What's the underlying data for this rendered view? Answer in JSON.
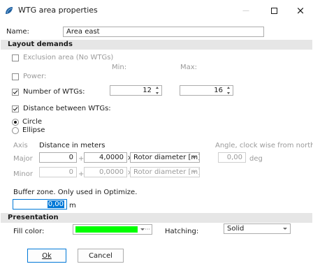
{
  "window": {
    "title": "WTG area properties",
    "minimize_glyph": "—",
    "close_glyph": "×"
  },
  "name_row": {
    "label": "Name:",
    "value": "Area east"
  },
  "layout": {
    "header": "Layout demands",
    "exclusion": {
      "label": "Exclusion area (No WTGs)",
      "checked": false
    },
    "min_label": "Min:",
    "max_label": "Max:",
    "power": {
      "label": "Power:",
      "checked": false
    },
    "number": {
      "label": "Number of WTGs:",
      "checked": true,
      "min": "12",
      "max": "16"
    },
    "distance": {
      "label": "Distance between WTGs:",
      "checked": true
    },
    "circle": {
      "label": "Circle",
      "selected": true
    },
    "ellipse": {
      "label": "Ellipse",
      "selected": false
    },
    "axis_label": "Axis",
    "distance_meters_label": "Distance in meters",
    "angle_label": "Angle, clock wise from north",
    "major": {
      "label": "Major",
      "meters": "0",
      "plus": "+",
      "factor": "4,0000",
      "times": "×",
      "unit": "Rotor diameter [m]",
      "angle": "0,00",
      "angle_unit": "deg"
    },
    "minor": {
      "label": "Minor",
      "meters": "0",
      "plus": "+",
      "factor": "0,0000",
      "times": "×",
      "unit": "Rotor diameter [m]"
    },
    "buffer_label": "Buffer zone. Only used in Optimize.",
    "buffer_value": "0,00",
    "buffer_unit": "m"
  },
  "presentation": {
    "header": "Presentation",
    "fill_label": "Fill color:",
    "fill_color": "#00ff00",
    "ellipsis": "···",
    "hatching_label": "Hatching:",
    "hatching_value": "Solid"
  },
  "buttons": {
    "ok": "Ok",
    "cancel": "Cancel"
  },
  "colors": {
    "accent": "#0078d7",
    "section_bg": "#e6e6e6",
    "app_icon": "#1f5f9f"
  }
}
